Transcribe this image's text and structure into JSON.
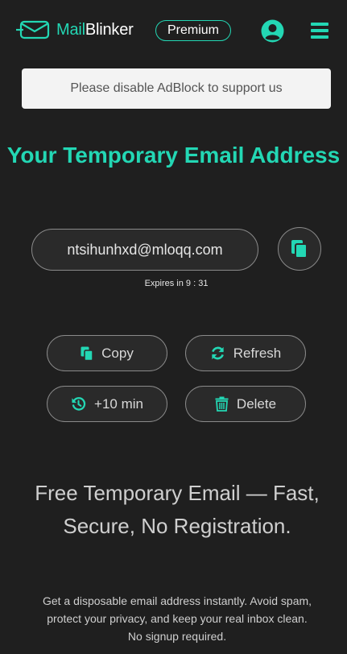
{
  "header": {
    "logo_mail": "Mail",
    "logo_blinker": "Blinker",
    "premium_label": "Premium"
  },
  "notice": {
    "adblock_text": "Please disable AdBlock to support us"
  },
  "main": {
    "title": "Your Temporary Email Address",
    "email_value": "ntsihunhxd@mloqq.com",
    "expires_text": "Expires in 9 : 31"
  },
  "actions": {
    "copy_label": "Copy",
    "refresh_label": "Refresh",
    "extend_label": "+10 min",
    "delete_label": "Delete"
  },
  "info": {
    "headline": "Free Temporary Email — Fast, Secure, No Registration.",
    "description": "Get a disposable email address instantly. Avoid spam, protect your privacy, and keep your real inbox clean. No signup required."
  },
  "colors": {
    "accent": "#23d7b4",
    "background": "#1f1f1f",
    "button_bg": "#2a2a2a"
  },
  "icons": [
    "envelope-logo-icon",
    "user-circle-icon",
    "menu-icon",
    "copy-icon",
    "refresh-icon",
    "history-icon",
    "trash-icon"
  ]
}
